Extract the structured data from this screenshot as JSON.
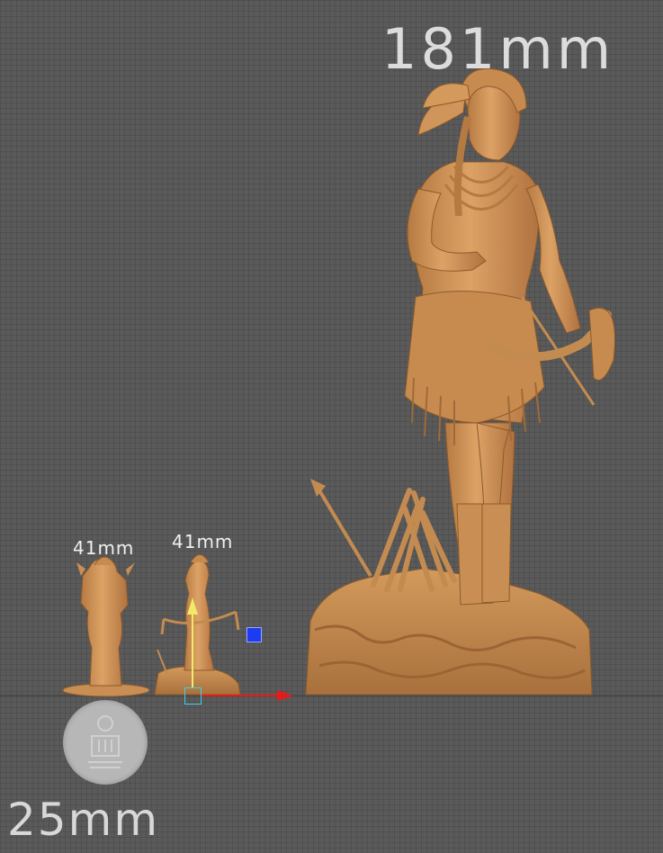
{
  "labels": {
    "main_figure_height": "181mm",
    "mini_left_height": "41mm",
    "mini_center_height": "41mm",
    "coin_size": "25mm"
  },
  "colors": {
    "background": "#5a5a5a",
    "model": "#d89a5e",
    "model_shadow": "#a8703c",
    "gizmo_x": "#e61a1a",
    "gizmo_y": "#f2e86a",
    "gizmo_z": "#1d3cf2",
    "gizmo_center": "#3fd0e6",
    "coin": "#b7b7b7"
  },
  "icons": {
    "coin_logo": "studio-logo-icon",
    "transform_gizmo": "move-gizmo-icon"
  }
}
